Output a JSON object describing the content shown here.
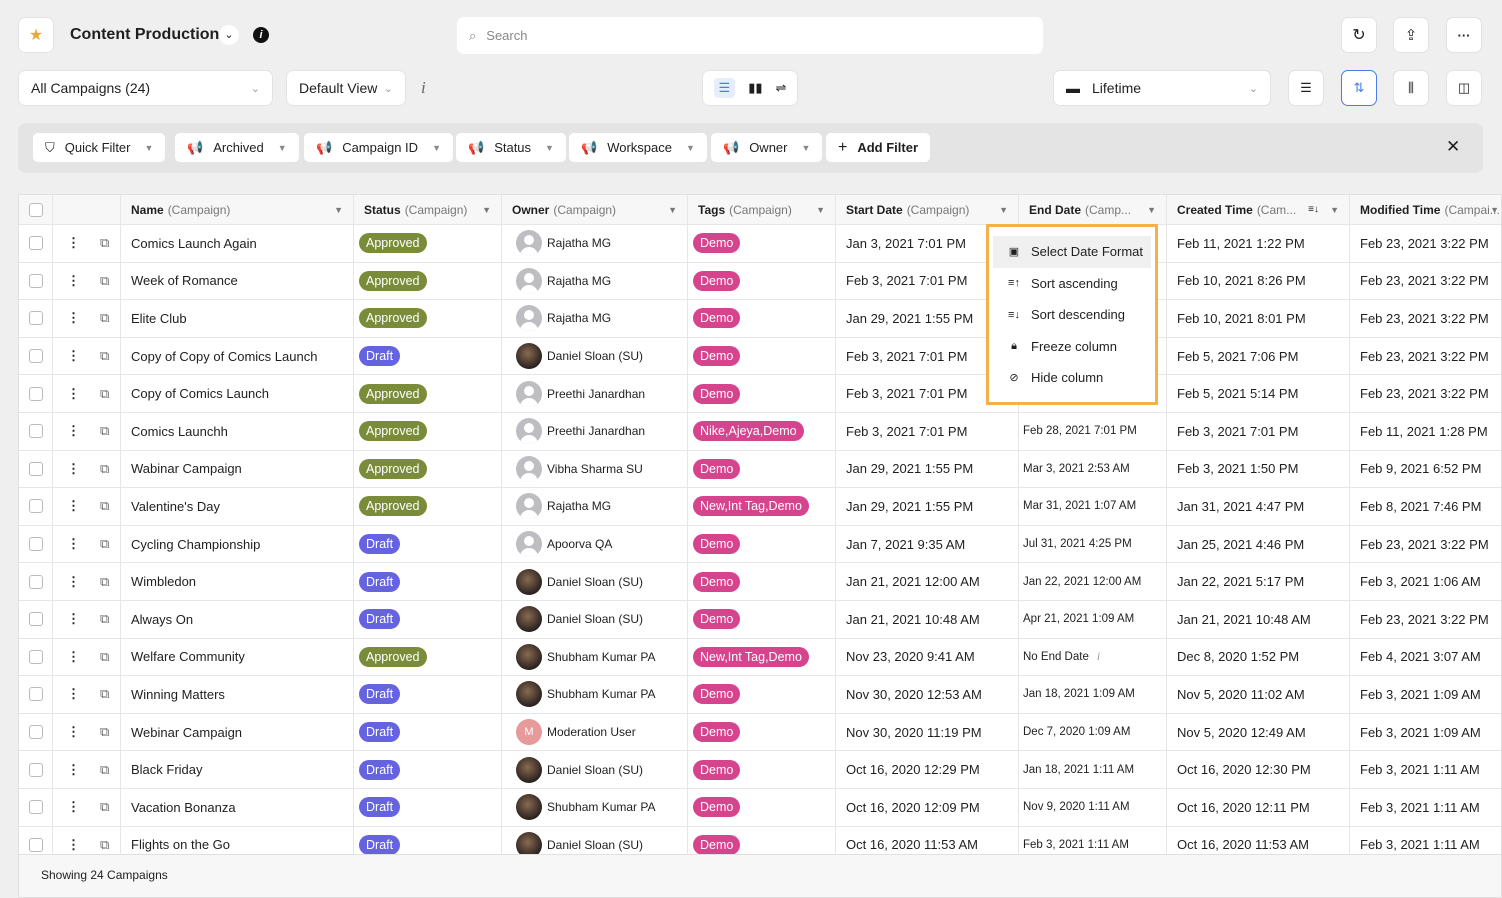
{
  "header": {
    "title": "Content Production",
    "search_placeholder": "Search"
  },
  "toolbar": {
    "campaign_filter": "All Campaigns (24)",
    "view": "Default View",
    "date_range": "Lifetime"
  },
  "filters": [
    {
      "label": "Quick Filter",
      "icon": "filter-icon"
    },
    {
      "label": "Archived",
      "icon": "megaphone-icon"
    },
    {
      "label": "Campaign ID",
      "icon": "megaphone-icon"
    },
    {
      "label": "Status",
      "icon": "megaphone-icon"
    },
    {
      "label": "Workspace",
      "icon": "megaphone-icon"
    },
    {
      "label": "Owner",
      "icon": "megaphone-icon"
    }
  ],
  "add_filter": "Add Filter",
  "columns": [
    {
      "name": "Name",
      "sub": "(Campaign)"
    },
    {
      "name": "Status",
      "sub": "(Campaign)"
    },
    {
      "name": "Owner",
      "sub": "(Campaign)"
    },
    {
      "name": "Tags",
      "sub": "(Campaign)"
    },
    {
      "name": "Start Date",
      "sub": "(Campaign)"
    },
    {
      "name": "End Date",
      "sub": "(Camp..."
    },
    {
      "name": "Created Time",
      "sub": "(Cam..."
    },
    {
      "name": "Modified Time",
      "sub": "(Campai..."
    }
  ],
  "colors": {
    "approved": "#7a8c3a",
    "draft": "#6563e0",
    "tag": "#d6448e",
    "menu_border": "#f3b04b",
    "accent": "#4a7cf0"
  },
  "rows": [
    [
      "Comics Launch Again",
      "Approved",
      "Rajatha MG",
      "default",
      "Demo",
      "Jan 3, 2021 7:01 PM",
      "",
      "Feb 11, 2021 1:22 PM",
      "Feb 23, 2021 3:22 PM"
    ],
    [
      "Week of Romance",
      "Approved",
      "Rajatha MG",
      "default",
      "Demo",
      "Feb 3, 2021 7:01 PM",
      "",
      "Feb 10, 2021 8:26 PM",
      "Feb 23, 2021 3:22 PM"
    ],
    [
      "Elite Club",
      "Approved",
      "Rajatha MG",
      "default",
      "Demo",
      "Jan 29, 2021 1:55 PM",
      "",
      "Feb 10, 2021 8:01 PM",
      "Feb 23, 2021 3:22 PM"
    ],
    [
      "Copy of Copy of Comics Launch",
      "Draft",
      "Daniel Sloan (SU)",
      "photo",
      "Demo",
      "Feb 3, 2021 7:01 PM",
      "",
      "Feb 5, 2021 7:06 PM",
      "Feb 23, 2021 3:22 PM"
    ],
    [
      "Copy of Comics Launch",
      "Approved",
      "Preethi Janardhan",
      "default",
      "Demo",
      "Feb 3, 2021 7:01 PM",
      "",
      "Feb 5, 2021 5:14 PM",
      "Feb 23, 2021 3:22 PM"
    ],
    [
      "Comics Launchh",
      "Approved",
      "Preethi Janardhan",
      "default",
      "Nike,Ajeya,Demo",
      "Feb 3, 2021 7:01 PM",
      "Feb 28, 2021 7:01 PM",
      "Feb 3, 2021 7:01 PM",
      "Feb 11, 2021 1:28 PM"
    ],
    [
      "Wabinar Campaign",
      "Approved",
      "Vibha Sharma SU",
      "default",
      "Demo",
      "Jan 29, 2021 1:55 PM",
      "Mar 3, 2021 2:53 AM",
      "Feb 3, 2021 1:50 PM",
      "Feb 9, 2021 6:52 PM"
    ],
    [
      "Valentine's Day",
      "Approved",
      "Rajatha MG",
      "default",
      "New,Int Tag,Demo",
      "Jan 29, 2021 1:55 PM",
      "Mar 31, 2021 1:07 AM",
      "Jan 31, 2021 4:47 PM",
      "Feb 8, 2021 7:46 PM"
    ],
    [
      "Cycling Championship",
      "Draft",
      "Apoorva QA",
      "default",
      "Demo",
      "Jan 7, 2021 9:35 AM",
      "Jul 31, 2021 4:25 PM",
      "Jan 25, 2021 4:46 PM",
      "Feb 23, 2021 3:22 PM"
    ],
    [
      "Wimbledon",
      "Draft",
      "Daniel Sloan (SU)",
      "photo",
      "Demo",
      "Jan 21, 2021 12:00 AM",
      "Jan 22, 2021 12:00 AM",
      "Jan 22, 2021 5:17 PM",
      "Feb 3, 2021 1:06 AM"
    ],
    [
      "Always On",
      "Draft",
      "Daniel Sloan (SU)",
      "photo",
      "Demo",
      "Jan 21, 2021 10:48 AM",
      "Apr 21, 2021 1:09 AM",
      "Jan 21, 2021 10:48 AM",
      "Feb 23, 2021 3:22 PM"
    ],
    [
      "Welfare Community",
      "Approved",
      "Shubham Kumar PA",
      "photo",
      "New,Int Tag,Demo",
      "Nov 23, 2020 9:41 AM",
      "No End Date",
      "Dec 8, 2020 1:52 PM",
      "Feb 4, 2021 3:07 AM"
    ],
    [
      "Winning Matters",
      "Draft",
      "Shubham Kumar PA",
      "photo",
      "Demo",
      "Nov 30, 2020 12:53 AM",
      "Jan 18, 2021 1:09 AM",
      "Nov 5, 2020 11:02 AM",
      "Feb 3, 2021 1:09 AM"
    ],
    [
      "Webinar Campaign",
      "Draft",
      "Moderation User",
      "initial",
      "Demo",
      "Nov 30, 2020 11:19 PM",
      "Dec 7, 2020 1:09 AM",
      "Nov 5, 2020 12:49 AM",
      "Feb 3, 2021 1:09 AM"
    ],
    [
      "Black Friday",
      "Draft",
      "Daniel Sloan (SU)",
      "photo",
      "Demo",
      "Oct 16, 2020 12:29 PM",
      "Jan 18, 2021 1:11 AM",
      "Oct 16, 2020 12:30 PM",
      "Feb 3, 2021 1:11 AM"
    ],
    [
      "Vacation Bonanza",
      "Draft",
      "Shubham Kumar PA",
      "photo",
      "Demo",
      "Oct 16, 2020 12:09 PM",
      "Nov 9, 2020 1:11 AM",
      "Oct 16, 2020 12:11 PM",
      "Feb 3, 2021 1:11 AM"
    ],
    [
      "Flights on the Go",
      "Draft",
      "Daniel Sloan (SU)",
      "photo",
      "Demo",
      "Oct 16, 2020 11:53 AM",
      "Feb 3, 2021 1:11 AM",
      "Oct 16, 2020 11:53 AM",
      "Feb 3, 2021 1:11 AM"
    ]
  ],
  "column_menu": [
    {
      "label": "Select Date Format",
      "icon": "calendar-icon"
    },
    {
      "label": "Sort ascending",
      "icon": "sort-ascending-icon"
    },
    {
      "label": "Sort descending",
      "icon": "sort-descending-icon"
    },
    {
      "label": "Freeze column",
      "icon": "lock-icon"
    },
    {
      "label": "Hide column",
      "icon": "eye-off-icon"
    }
  ],
  "footer": {
    "text": "Showing 24 Campaigns"
  }
}
